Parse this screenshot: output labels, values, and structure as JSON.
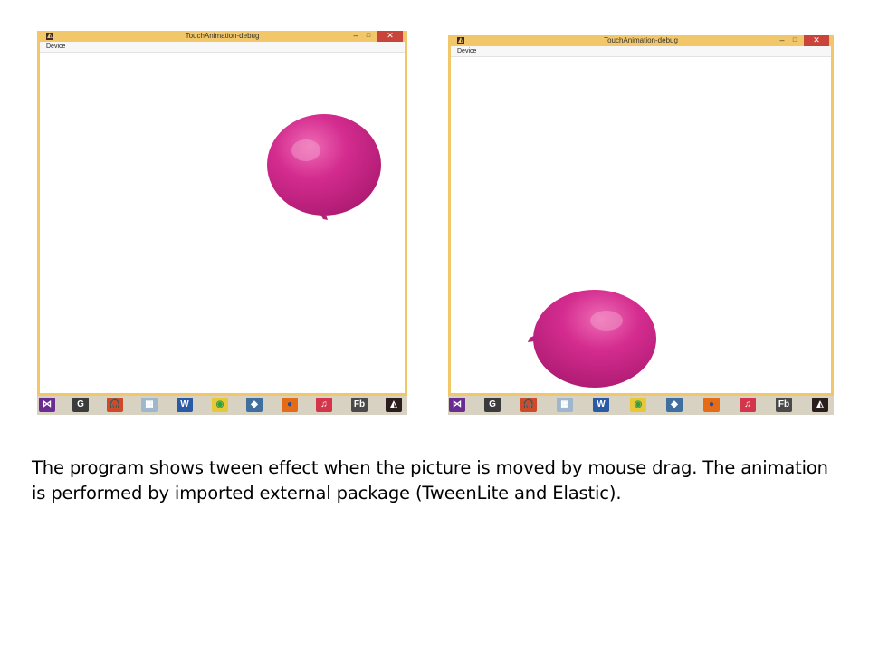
{
  "windows": [
    {
      "title": "TouchAnimation-debug",
      "menu": [
        "Device"
      ],
      "controls": {
        "minimize": "–",
        "maximize": "□",
        "close": "✕"
      }
    },
    {
      "title": "TouchAnimation-debug",
      "menu": [
        "Device"
      ],
      "controls": {
        "minimize": "–",
        "maximize": "□",
        "close": "✕"
      }
    }
  ],
  "taskbar_icons": [
    {
      "name": "visual-studio-icon",
      "glyph": "⋈",
      "bg": "#6a2c91",
      "fg": "#ffffff"
    },
    {
      "name": "g-app-icon",
      "glyph": "G",
      "bg": "#3b3b3b",
      "fg": "#ffffff"
    },
    {
      "name": "headphones-app-icon",
      "glyph": "🎧",
      "bg": "#d04a2a",
      "fg": "#ffffff"
    },
    {
      "name": "calculator-icon",
      "glyph": "▦",
      "bg": "#9fb6cf",
      "fg": "#ffffff"
    },
    {
      "name": "word-icon",
      "glyph": "W",
      "bg": "#2a5aa6",
      "fg": "#ffffff"
    },
    {
      "name": "chrome-icon",
      "glyph": "◉",
      "bg": "#e8c838",
      "fg": "#2f9e44"
    },
    {
      "name": "box-app-icon",
      "glyph": "◆",
      "bg": "#3f6f9f",
      "fg": "#ffffff"
    },
    {
      "name": "firefox-icon",
      "glyph": "●",
      "bg": "#e66b17",
      "fg": "#1d4f9c"
    },
    {
      "name": "music-app-icon",
      "glyph": "♫",
      "bg": "#d3364b",
      "fg": "#ffffff"
    },
    {
      "name": "flash-builder-icon",
      "glyph": "Fb",
      "bg": "#4a4a4a",
      "fg": "#ffffff"
    },
    {
      "name": "air-app-icon",
      "glyph": "◭",
      "bg": "#2b1d1d",
      "fg": "#ffffff"
    }
  ],
  "caption": "The program shows tween effect when the picture is moved by mouse drag. The animation is performed by imported external package (TweenLite and Elastic).",
  "colors": {
    "window_frame": "#f2c76a",
    "balloon": "#d42c8f",
    "taskbar": "#d8d2c2"
  }
}
